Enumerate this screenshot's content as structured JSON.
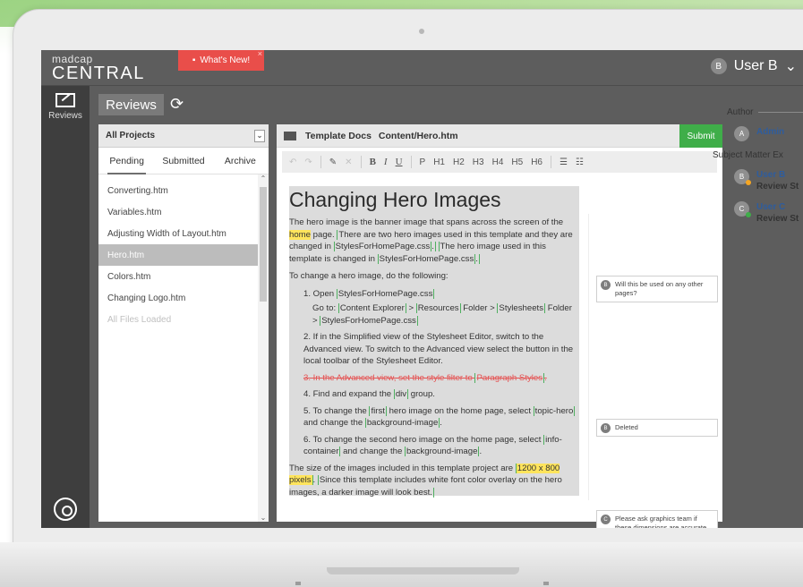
{
  "app": {
    "logo_small": "madcap",
    "logo_big": "CENTRAL",
    "whats_new": "What's New!",
    "user_initial": "B",
    "user_name": "User B"
  },
  "rail": {
    "reviews_label": "Reviews"
  },
  "page": {
    "tab_label": "Reviews"
  },
  "files": {
    "project_select": "All Projects",
    "tabs": [
      "Pending",
      "Submitted",
      "Archive"
    ],
    "items": [
      "Converting.htm",
      "Variables.htm",
      "Adjusting Width of Layout.htm",
      "Hero.htm",
      "Colors.htm",
      "Changing Logo.htm",
      "All Files Loaded"
    ]
  },
  "editor": {
    "project": "Template Docs",
    "path": "Content/Hero.htm",
    "submit": "Submit",
    "toolbar": [
      "B",
      "I",
      "U",
      "P",
      "H1",
      "H2",
      "H3",
      "H4",
      "H5",
      "H6"
    ]
  },
  "doc": {
    "title": "Changing Hero Images",
    "p1_a": "The hero image is the banner image that spans across the screen of the",
    "p1_hl": "home",
    "p1_b": "page.",
    "p1_c": "There are two hero images used in this template and they are changed in",
    "tag_styles": "StylesForHomePage.css",
    "p1_d": "The hero image used in this template is changed in",
    "p2": "To change a hero image, do the following:",
    "s1_a": "1. Open",
    "s1_go": "Go to:",
    "s1_ce": "Content Explorer",
    "s1_res": "Resources",
    "s1_folder": "Folder >",
    "s1_ss": "Stylesheets",
    "s2": "2. If in the Simplified view of the Stylesheet Editor, switch to the Advanced view. To switch to the Advanced view select the button in the local toolbar of the Stylesheet Editor.",
    "s3_a": "3. In the Advanced view, set the style filter to",
    "s3_tag": "Paragraph Styles",
    "s4_a": "4. Find and expand the",
    "s4_tag": "div",
    "s4_b": "group.",
    "s5_a": "5. To change the",
    "s5_tag1": "first",
    "s5_b": "hero image on the home page, select",
    "s5_tag2": "topic-hero",
    "s5_c": "and change the",
    "s5_tag3": "background-image",
    "s6_a": "6. To change the second hero image on the home page, select",
    "s6_tag1": "info-container",
    "s6_b": "and change the",
    "s6_tag2": "background-image",
    "p3_a": "The size of the images included in this template project are",
    "p3_hl": "1200 x 800 pixels",
    "p3_b": "Since this template includes white font color overlay on the hero images, a darker image will look best."
  },
  "comments": [
    {
      "initial": "B",
      "text": "Will this be used on any other pages?"
    },
    {
      "initial": "B",
      "text": "Deleted"
    },
    {
      "initial": "C",
      "text": "Please ask graphics team if these dimensions are accurate"
    }
  ],
  "side": {
    "author_label": "Author",
    "author": {
      "initial": "A",
      "name": "Admin"
    },
    "sme_label": "Subject Matter Ex",
    "reviewers": [
      {
        "initial": "B",
        "name": "User B",
        "status": "Review St",
        "dot": "#f5a623"
      },
      {
        "initial": "C",
        "name": "User C",
        "status": "Review St",
        "dot": "#3fae49"
      }
    ]
  },
  "colors": {
    "accent_green": "#3fae49",
    "whats_new_red": "#e94e4a",
    "name_blue": "#2e5d9e"
  }
}
